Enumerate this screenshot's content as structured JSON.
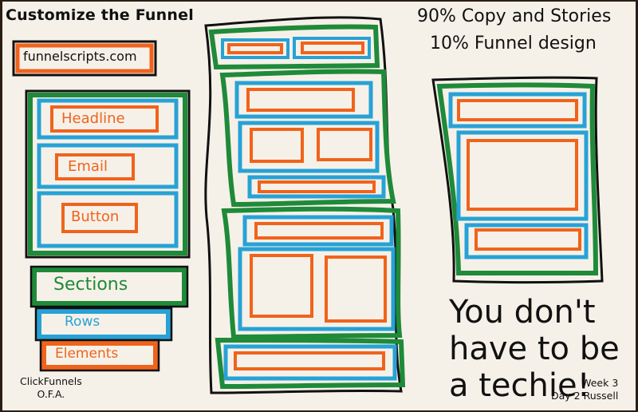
{
  "title": "Customize the Funnel",
  "domain_box": "funnelscripts.com",
  "elements_stack": [
    "Headline",
    "Email",
    "Button"
  ],
  "legend": {
    "sections": "Sections",
    "rows": "Rows",
    "elements": "Elements"
  },
  "ratio": {
    "line1": "90% Copy and Stories",
    "line2": "10% Funnel design"
  },
  "techie": [
    "You don't",
    "have to be",
    "a techie!"
  ],
  "footer_left": [
    "ClickFunnels",
    "O.F.A."
  ],
  "footer_right": [
    "Week 3",
    "Day 2 Russell"
  ],
  "colors": {
    "green": "#1f8a3a",
    "blue": "#27a2d6",
    "orange": "#f0631c",
    "ink": "#111111",
    "paper": "#f6f1e8"
  }
}
